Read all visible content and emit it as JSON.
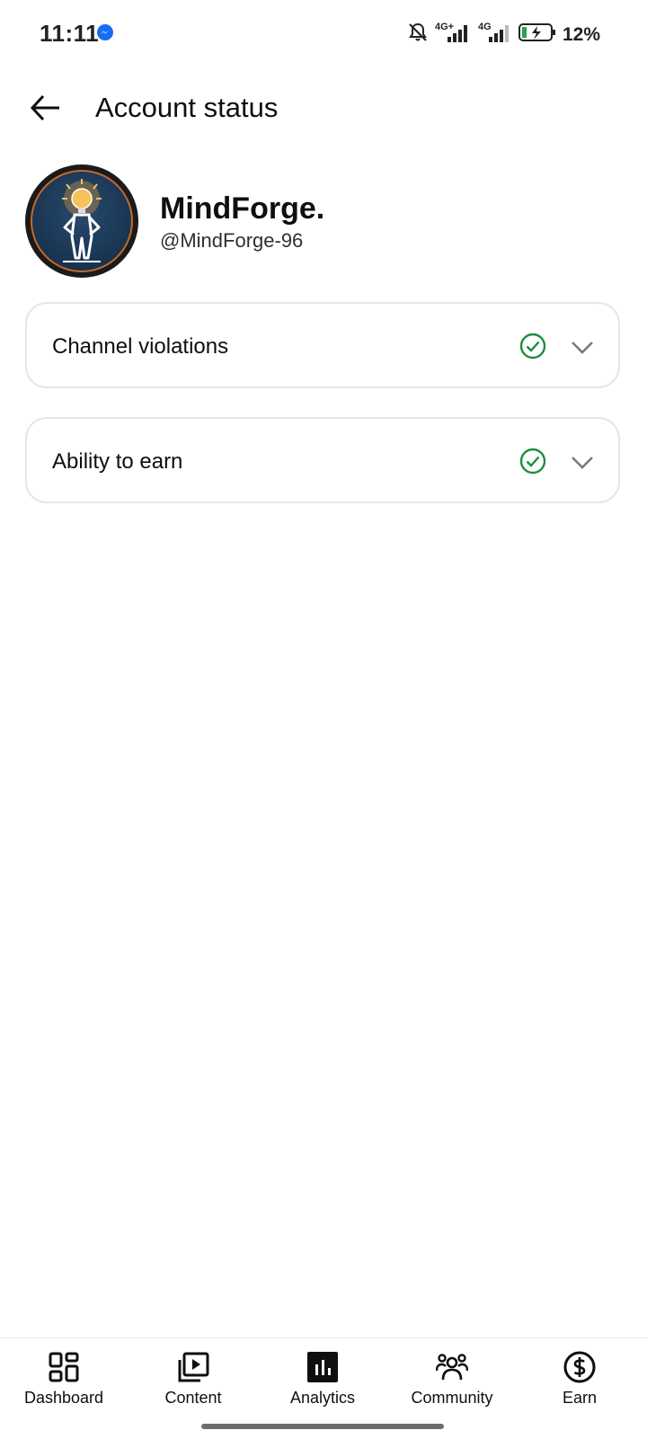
{
  "status_bar": {
    "time": "11:11",
    "network_1": "4G+",
    "network_2": "4G",
    "battery_percent": "12%"
  },
  "header": {
    "title": "Account status"
  },
  "channel": {
    "name": "MindForge.",
    "handle": "@MindForge-96"
  },
  "cards": [
    {
      "label": "Channel violations",
      "status_icon": "check-circle-icon",
      "status_color": "#1e8e3e"
    },
    {
      "label": "Ability to earn",
      "status_icon": "check-circle-icon",
      "status_color": "#1e8e3e"
    }
  ],
  "bottom_nav": [
    {
      "label": "Dashboard",
      "icon": "dashboard-icon"
    },
    {
      "label": "Content",
      "icon": "content-icon"
    },
    {
      "label": "Analytics",
      "icon": "analytics-icon",
      "selected": true
    },
    {
      "label": "Community",
      "icon": "community-icon"
    },
    {
      "label": "Earn",
      "icon": "earn-icon"
    }
  ]
}
